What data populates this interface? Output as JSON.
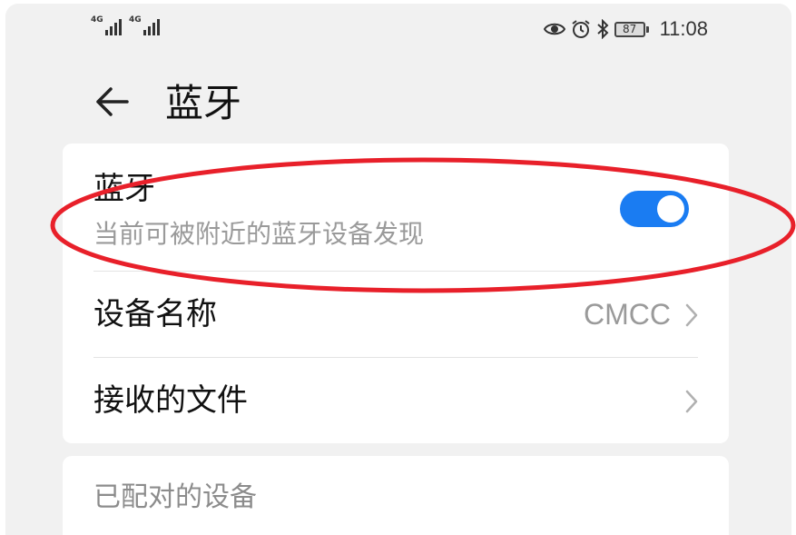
{
  "status_bar": {
    "signal_1_label": "4G",
    "signal_2_label": "4G",
    "battery_level": "87",
    "time": "11:08",
    "icons": [
      "eye-icon",
      "alarm-icon",
      "bluetooth-icon"
    ]
  },
  "header": {
    "title": "蓝牙",
    "back_icon": "arrow-left-icon"
  },
  "settings": {
    "bluetooth": {
      "title": "蓝牙",
      "subtitle": "当前可被附近的蓝牙设备发现",
      "enabled": true
    },
    "device_name": {
      "label": "设备名称",
      "value": "CMCC"
    },
    "received_files": {
      "label": "接收的文件"
    }
  },
  "paired_section": {
    "label": "已配对的设备"
  },
  "colors": {
    "accent": "#1a7cf2",
    "annotation": "#e8202a",
    "background": "#f1f1f1",
    "card": "#ffffff"
  }
}
